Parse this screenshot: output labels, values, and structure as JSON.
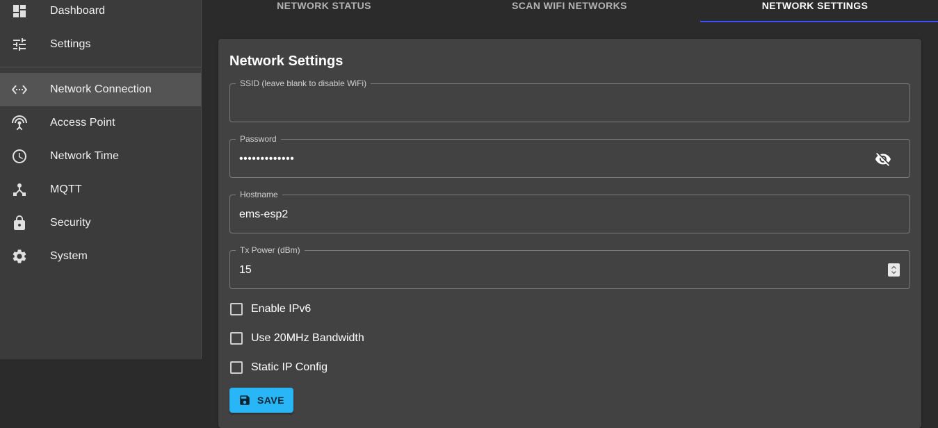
{
  "sidebar": {
    "items": [
      {
        "label": "Dashboard",
        "icon": "dashboard-icon"
      },
      {
        "label": "Settings",
        "icon": "tune-icon"
      },
      {
        "label": "Network Connection",
        "icon": "settings-ethernet-icon",
        "active": true
      },
      {
        "label": "Access Point",
        "icon": "access-point-icon"
      },
      {
        "label": "Network Time",
        "icon": "clock-icon"
      },
      {
        "label": "MQTT",
        "icon": "mqtt-hub-icon"
      },
      {
        "label": "Security",
        "icon": "lock-icon"
      },
      {
        "label": "System",
        "icon": "gear-icon"
      }
    ]
  },
  "tabs": [
    {
      "label": "NETWORK STATUS"
    },
    {
      "label": "SCAN WIFI NETWORKS"
    },
    {
      "label": "NETWORK SETTINGS",
      "active": true
    }
  ],
  "form": {
    "title": "Network Settings",
    "ssid": {
      "label": "SSID (leave blank to disable WiFi)",
      "value": ""
    },
    "password": {
      "label": "Password",
      "value": "•••••••••••••"
    },
    "hostname": {
      "label": "Hostname",
      "value": "ems-esp2"
    },
    "tx_power": {
      "label": "Tx Power (dBm)",
      "value": "15"
    },
    "checkboxes": [
      {
        "label": "Enable IPv6",
        "checked": false
      },
      {
        "label": "Use 20MHz Bandwidth",
        "checked": false
      },
      {
        "label": "Static IP Config",
        "checked": false
      }
    ],
    "save_label": "SAVE"
  },
  "colors": {
    "accent_tab": "#3f51ff",
    "save_button": "#29b6f6",
    "sidebar_bg": "#3b3b3b",
    "card_bg": "#424242",
    "page_bg": "#2b2b2b"
  }
}
